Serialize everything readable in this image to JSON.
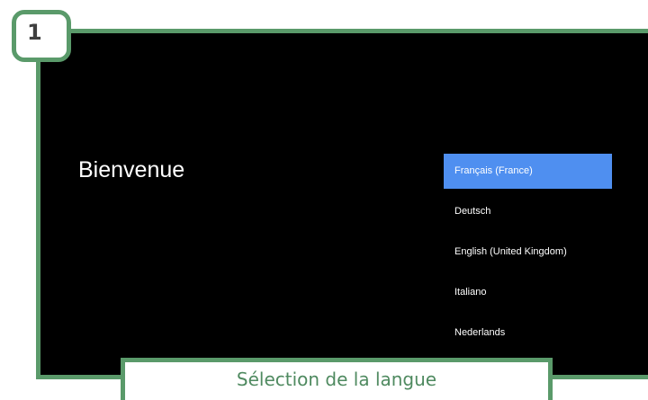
{
  "step": {
    "number": "1"
  },
  "screen": {
    "title": "Bienvenue",
    "languages": [
      {
        "label": "Français (France)",
        "selected": true
      },
      {
        "label": "Deutsch",
        "selected": false
      },
      {
        "label": "English (United Kingdom)",
        "selected": false
      },
      {
        "label": "Italiano",
        "selected": false
      },
      {
        "label": "Nederlands",
        "selected": false
      }
    ]
  },
  "caption": {
    "text": "Sélection de la langue"
  },
  "colors": {
    "frame": "#5a9a6a",
    "selected_item": "#4f8ff0",
    "screen_background": "#000000"
  }
}
